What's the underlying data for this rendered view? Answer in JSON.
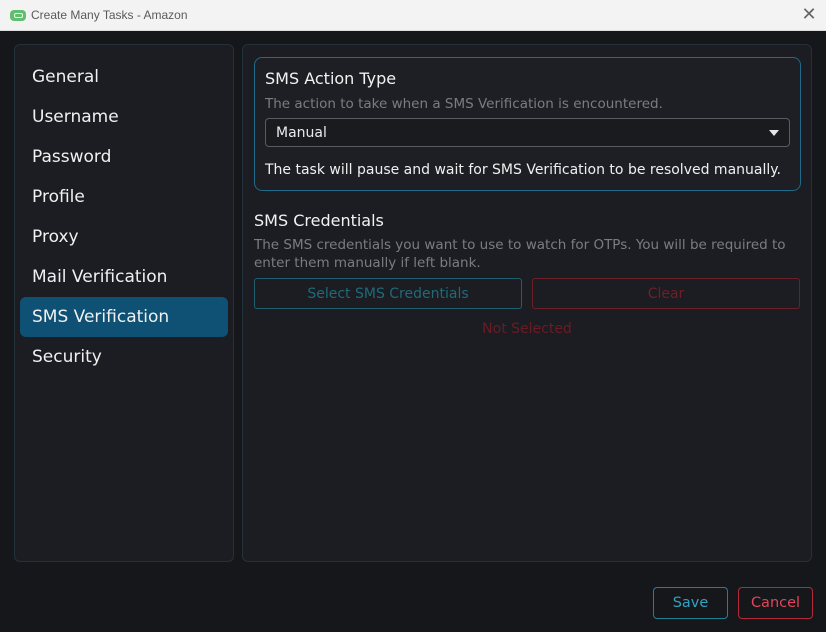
{
  "window": {
    "title": "Create Many Tasks - Amazon",
    "app_icon": "app-icon",
    "close_icon": "close-icon"
  },
  "sidebar": {
    "items": [
      {
        "label": "General"
      },
      {
        "label": "Username"
      },
      {
        "label": "Password"
      },
      {
        "label": "Profile"
      },
      {
        "label": "Proxy"
      },
      {
        "label": "Mail Verification"
      },
      {
        "label": "SMS Verification",
        "active": true
      },
      {
        "label": "Security"
      }
    ]
  },
  "sms_action": {
    "title": "SMS Action Type",
    "description": "The action to take when a SMS Verification is encountered.",
    "selected": "Manual",
    "note": "The task will pause and wait for SMS Verification to be resolved manually."
  },
  "sms_credentials": {
    "title": "SMS Credentials",
    "description": "The SMS credentials you want to use to watch for OTPs. You will be required to enter them manually if left blank.",
    "select_label": "Select SMS Credentials",
    "clear_label": "Clear",
    "status": "Not Selected"
  },
  "footer": {
    "save_label": "Save",
    "cancel_label": "Cancel"
  },
  "colors": {
    "accent": "#0f5175",
    "save": "#33a2c1",
    "cancel": "#e0455a"
  }
}
